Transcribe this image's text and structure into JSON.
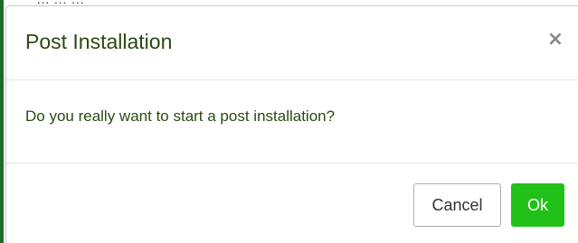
{
  "background": {
    "partial_text": "… … …"
  },
  "dialog": {
    "title": "Post Installation",
    "close_symbol": "×",
    "close_icon": "close-icon",
    "message": "Do you really want to start a post installation?",
    "buttons": {
      "cancel_label": "Cancel",
      "ok_label": "Ok"
    }
  },
  "colors": {
    "title_text": "#2a4a12",
    "ok_button": "#21c11a",
    "ok_text": "#ffffff",
    "close_icon": "#888888"
  }
}
